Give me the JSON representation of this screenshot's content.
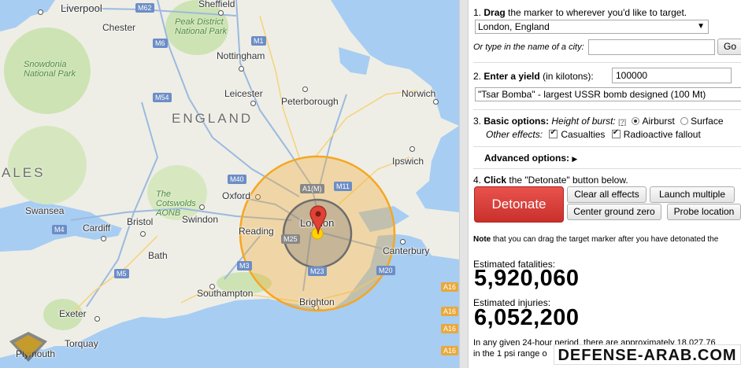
{
  "map": {
    "cities": [
      "Liverpool",
      "Sheffield",
      "Chester",
      "Nottingham",
      "Leicester",
      "Peterborough",
      "Norwich",
      "Ipswich",
      "Oxford",
      "Swindon",
      "Reading",
      "London",
      "Swansea",
      "Cardiff",
      "Bristol",
      "Bath",
      "Southampton",
      "Brighton",
      "Exeter",
      "Torquay",
      "Canterbury",
      "Plymouth"
    ],
    "regions": [
      "ENGLAND",
      "ALES"
    ],
    "parks": [
      "Peak District National Park",
      "Snowdonia National Park",
      "The Cotswolds AONB"
    ],
    "roads": [
      "M62",
      "M6",
      "M1",
      "M54",
      "A1(M)",
      "M11",
      "M40",
      "M4",
      "M5",
      "M25",
      "M3",
      "M23",
      "M20",
      "A16",
      "A16",
      "A16",
      "A16"
    ],
    "colors": {
      "fireball": "#ffd400",
      "moderate_radiation": "#7a7a7a",
      "air_blast": "#f5a623",
      "marker": "#e04236",
      "land": "#eeeee6",
      "water": "#a7cdf2",
      "park": "#cde3b4"
    }
  },
  "panel": {
    "step1_num": "1.",
    "step1_bold": "Drag",
    "step1_rest": "the marker to wherever you'd like to target.",
    "city_select": "London, England",
    "city_input_label": "Or type in the name of a city:",
    "city_input_value": "",
    "go_label": "Go",
    "step2_num": "2.",
    "step2_bold": "Enter a yield",
    "step2_rest": "(in kilotons):",
    "yield_value": "100000",
    "preset_select": "\"Tsar Bomba\" - largest USSR bomb designed (100 Mt)",
    "step3_num": "3.",
    "step3_bold": "Basic options:",
    "height_label": "Height of burst:",
    "help_link": "[?]",
    "airburst_label": "Airburst",
    "surface_label": "Surface",
    "other_effects_label": "Other effects:",
    "casualties_label": "Casualties",
    "fallout_label": "Radioactive fallout",
    "advanced_label": "Advanced options:",
    "advanced_arrow": "▶",
    "step4_num": "4.",
    "step4_bold": "Click",
    "step4_rest": "the \"Detonate\" button below.",
    "detonate_label": "Detonate",
    "clear_label": "Clear all effects",
    "launch_label": "Launch multiple",
    "center_label": "Center ground zero",
    "probe_label": "Probe location",
    "note_bold": "Note",
    "note_rest": "that you can drag the target marker after you have detonated the",
    "fatalities_label": "Estimated fatalities:",
    "fatalities_value": "5,920,060",
    "injuries_label": "Estimated injuries:",
    "injuries_value": "6,052,200",
    "footer_line1": "In any given 24-hour period, there are approximately 18,027,76",
    "footer_line2": "in the 1 psi range o"
  },
  "watermark": "DEFENSE-ARAB.COM"
}
